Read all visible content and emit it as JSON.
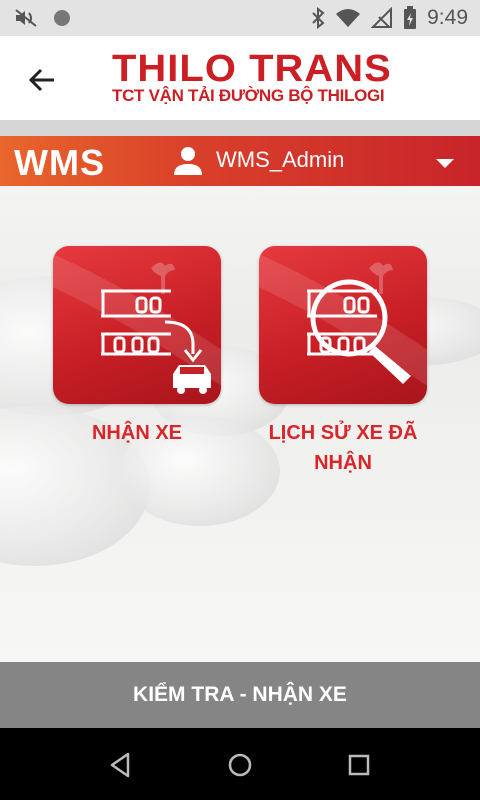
{
  "status_bar": {
    "time": "9:49",
    "left_icons": [
      "mute-icon",
      "circle-status-icon"
    ],
    "right_icons": [
      "bluetooth-icon",
      "wifi-icon",
      "no-signal-icon",
      "battery-icon"
    ]
  },
  "app_bar": {
    "brand_name_left": "THI",
    "brand_name_mid": "L",
    "brand_name_right": "O TRANS",
    "brand_subtitle": "TCT VẬN TẢI ĐƯỜNG BỘ THILOGI"
  },
  "header": {
    "title": "WMS",
    "username": "WMS_Admin"
  },
  "tiles": [
    {
      "label": "NHẬN XE"
    },
    {
      "label_line1": "LỊCH SỬ XE ĐÃ",
      "label_line2": "NHẬN"
    }
  ],
  "bottom_button": {
    "label": "KIỂM TRA - NHẬN XE"
  },
  "colors": {
    "brand_red": "#cc1f24",
    "header_gradient_start": "#e9662c",
    "header_gradient_end": "#c8242a",
    "bottom_button_bg": "#858585"
  }
}
